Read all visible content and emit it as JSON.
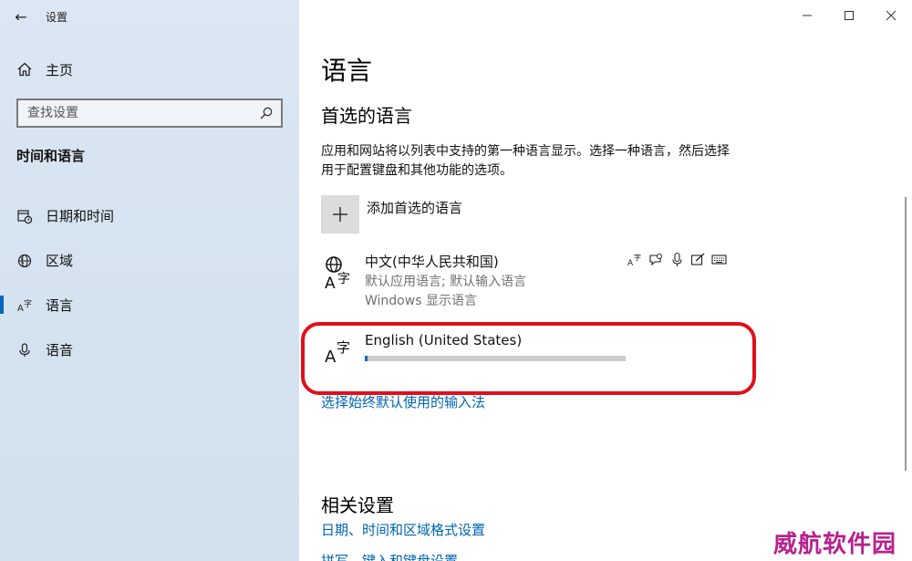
{
  "window": {
    "app_title": "设置",
    "back_glyph": "←",
    "controls": {
      "minimize": "─",
      "maximize": "☐",
      "close": "✕"
    }
  },
  "sidebar": {
    "home_label": "主页",
    "search_placeholder": "查找设置",
    "section_title": "时间和语言",
    "items": [
      {
        "label": "日期和时间",
        "icon": "calendar-clock-icon",
        "active": false
      },
      {
        "label": "区域",
        "icon": "globe-region-icon",
        "active": false
      },
      {
        "label": "语言",
        "icon": "language-icon",
        "active": true
      },
      {
        "label": "语音",
        "icon": "microphone-icon",
        "active": false
      }
    ]
  },
  "main": {
    "page_title": "语言",
    "preferred_title": "首选的语言",
    "description": "应用和网站将以列表中支持的第一种语言显示。选择一种语言，然后选择用于配置键盘和其他功能的选项。",
    "add_language_label": "添加首选的语言",
    "languages": [
      {
        "name": "中文(中华人民共和国)",
        "sub1": "默认应用语言; 默认输入语言",
        "sub2": "Windows 显示语言",
        "capabilities": [
          "language-pack-icon",
          "speech-bubble-icon",
          "microphone-icon",
          "handwriting-icon",
          "keyboard-icon"
        ]
      },
      {
        "name": "English (United States)",
        "progress": 0.01
      }
    ],
    "input_method_link": "选择始终默认使用的输入法",
    "related_title": "相关设置",
    "related_link": "日期、时间和区域格式设置",
    "peek_link": "拼写、键入和键盘设置"
  },
  "watermark": "威航软件园",
  "colors": {
    "accent": "#0067c0",
    "link": "#0063b1",
    "highlight": "#e0101a",
    "watermark": "#b6228e"
  }
}
